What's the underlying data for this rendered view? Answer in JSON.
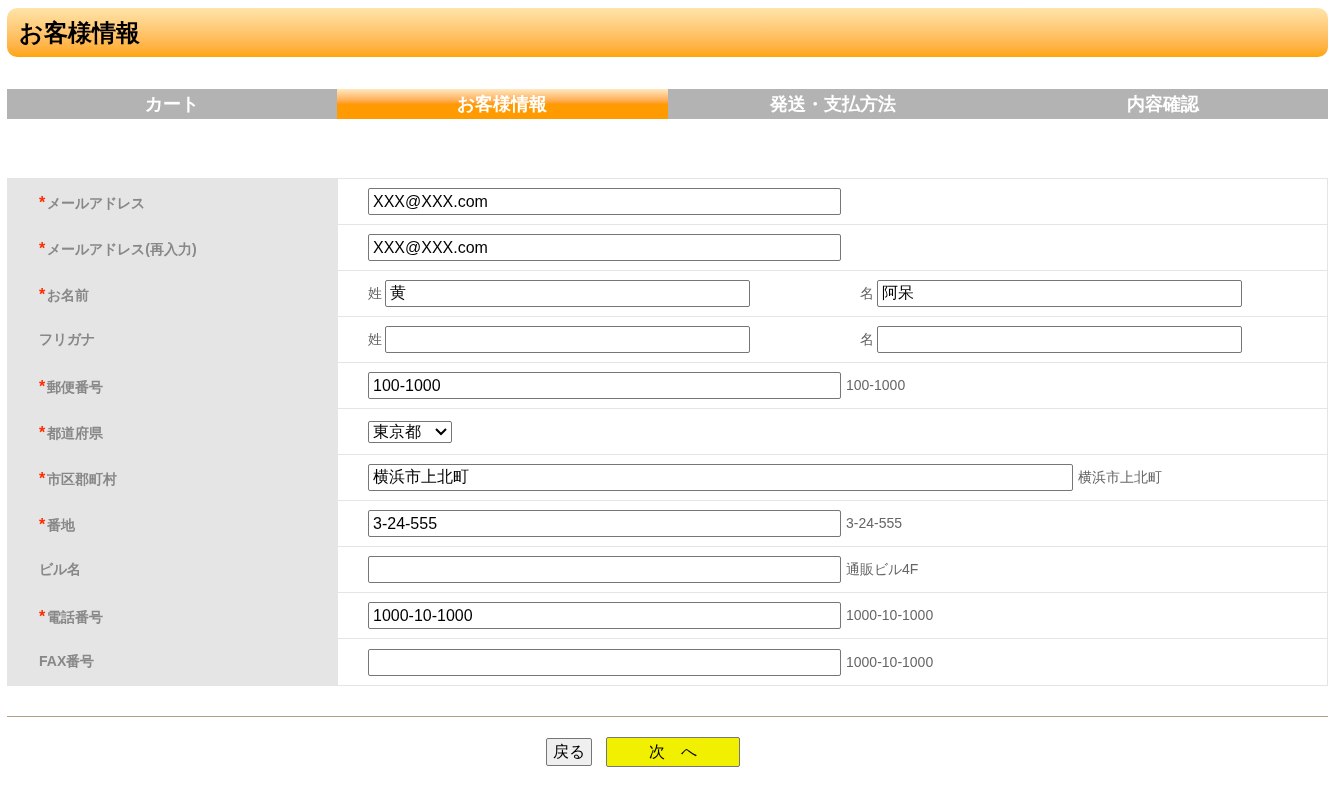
{
  "header": {
    "title": "お客様情報"
  },
  "steps": [
    {
      "label": "カート",
      "selected": false
    },
    {
      "label": "お客様情報",
      "selected": true
    },
    {
      "label": "発送・支払方法",
      "selected": false
    },
    {
      "label": "内容確認",
      "selected": false
    }
  ],
  "required_mark": "*",
  "fields": [
    {
      "kind": "text",
      "label": "メールアドレス",
      "required": true,
      "value": "XXX@XXX.com"
    },
    {
      "kind": "text",
      "label": "メールアドレス(再入力)",
      "required": true,
      "value": "XXX@XXX.com"
    },
    {
      "kind": "pair",
      "label": "お名前",
      "required": true,
      "parts": [
        {
          "prefix": "姓",
          "value": "黄"
        },
        {
          "prefix": "名",
          "value": "阿呆"
        }
      ]
    },
    {
      "kind": "pair",
      "label": "フリガナ",
      "required": false,
      "parts": [
        {
          "prefix": "姓"
        },
        {
          "prefix": "名"
        }
      ]
    },
    {
      "kind": "text",
      "label": "郵便番号",
      "required": true,
      "value": "100-1000",
      "example": "100-1000"
    },
    {
      "kind": "select",
      "label": "都道府県",
      "required": true,
      "value": "東京都"
    },
    {
      "kind": "wide",
      "label": "市区郡町村",
      "required": true,
      "value": "横浜市上北町",
      "example": "横浜市上北町"
    },
    {
      "kind": "text",
      "label": "番地",
      "required": true,
      "value": "3-24-555",
      "example": "3-24-555"
    },
    {
      "kind": "text",
      "label": "ビル名",
      "required": false,
      "example": "通販ビル4F"
    },
    {
      "kind": "text",
      "label": "電話番号",
      "required": true,
      "value": "1000-10-1000",
      "example": "1000-10-1000"
    },
    {
      "kind": "text",
      "label": "FAX番号",
      "required": false,
      "example": "1000-10-1000"
    }
  ],
  "buttons": {
    "back": "戻る",
    "next": "次　へ"
  }
}
